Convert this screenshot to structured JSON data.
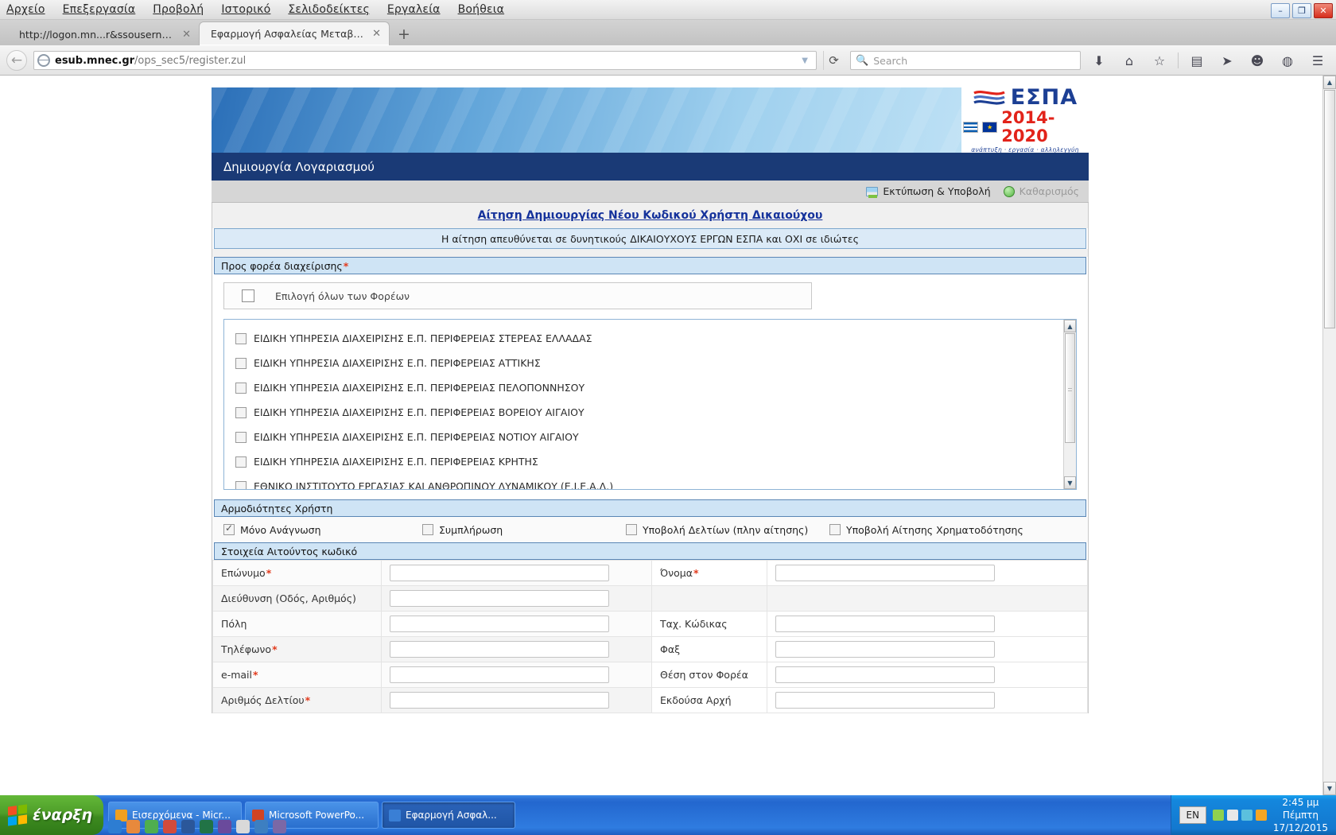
{
  "browser": {
    "menu": [
      "Αρχείο",
      "Επεξεργασία",
      "Προβολή",
      "Ιστορικό",
      "Σελιδοδείκτες",
      "Εργαλεία",
      "Βοήθεια"
    ],
    "window_controls": {
      "minimize": "–",
      "maximize": "❐",
      "close": "✕"
    },
    "tabs": [
      {
        "label": "http://logon.mn...r&ssousername=",
        "active": false
      },
      {
        "label": "Εφαρμογή Ασφαλείας Μεταβατικο...",
        "active": true
      }
    ],
    "new_tab_label": "+",
    "url_domain": "esub.mnec.gr",
    "url_path": "/ops_sec5/register.zul",
    "url_full": "esub.mnec.gr/ops_sec5/register.zul",
    "search_placeholder": "Search",
    "reload_label": "⟳",
    "back_label": "←",
    "toolbar_icons": [
      "download-icon",
      "home-icon",
      "bookmark-star-icon",
      "reader-icon",
      "pocket-icon",
      "smiley-icon",
      "sync-icon",
      "menu-hamburger-icon"
    ]
  },
  "page": {
    "espa_logo": {
      "word": "ΕΣΠΑ",
      "years": "2014-2020",
      "tagline": "ανάπτυξη · εργασία · αλληλεγγύη"
    },
    "title": "Δημιουργία Λογαριασμού",
    "toolbar": {
      "print_submit": "Εκτύπωση & Υποβολή",
      "clear": "Καθαρισμός"
    },
    "main_link": "Αίτηση Δημιουργίας Νέου Κωδικού Χρήστη Δικαιούχου",
    "notice": "Η αίτηση απευθύνεται σε δυνητικούς ΔΙΚΑΙΟΥΧΟΥΣ ΕΡΓΩΝ ΕΣΠΑ και ΟΧΙ σε ιδιώτες",
    "sections": {
      "authority": {
        "header": "Προς φορέα διαχείρισης",
        "required": "*",
        "select_all_label": "Επιλογή όλων των Φορέων",
        "select_all_checked": false,
        "items": [
          {
            "label": "ΕΙΔΙΚΗ ΥΠΗΡΕΣΙΑ ΔΙΑΧΕΙΡΙΣΗΣ Ε.Π. ΠΕΡΙΦΕΡΕΙΑΣ ΣΤΕΡΕΑΣ ΕΛΛΑΔΑΣ",
            "checked": false
          },
          {
            "label": "ΕΙΔΙΚΗ ΥΠΗΡΕΣΙΑ ΔΙΑΧΕΙΡΙΣΗΣ Ε.Π. ΠΕΡΙΦΕΡΕΙΑΣ ΑΤΤΙΚΗΣ",
            "checked": false
          },
          {
            "label": "ΕΙΔΙΚΗ ΥΠΗΡΕΣΙΑ ΔΙΑΧΕΙΡΙΣΗΣ Ε.Π. ΠΕΡΙΦΕΡΕΙΑΣ ΠΕΛΟΠΟΝΝΗΣΟΥ",
            "checked": false
          },
          {
            "label": "ΕΙΔΙΚΗ ΥΠΗΡΕΣΙΑ ΔΙΑΧΕΙΡΙΣΗΣ Ε.Π. ΠΕΡΙΦΕΡΕΙΑΣ ΒΟΡΕΙΟΥ ΑΙΓΑΙΟΥ",
            "checked": false
          },
          {
            "label": "ΕΙΔΙΚΗ ΥΠΗΡΕΣΙΑ ΔΙΑΧΕΙΡΙΣΗΣ Ε.Π. ΠΕΡΙΦΕΡΕΙΑΣ ΝΟΤΙΟΥ ΑΙΓΑΙΟΥ",
            "checked": false
          },
          {
            "label": "ΕΙΔΙΚΗ ΥΠΗΡΕΣΙΑ ΔΙΑΧΕΙΡΙΣΗΣ Ε.Π. ΠΕΡΙΦΕΡΕΙΑΣ ΚΡΗΤΗΣ",
            "checked": false
          },
          {
            "label": "ΕΘΝΙΚΟ ΙΝΣΤΙΤΟΥΤΟ ΕΡΓΑΣΙΑΣ ΚΑΙ ΑΝΘΡΩΠΙΝΟΥ ΔΥΝΑΜΙΚΟΥ (Ε.Ι.Ε.Α.Δ.)",
            "checked": false
          }
        ]
      },
      "permissions": {
        "header": "Αρμοδιότητες Χρήστη",
        "options": [
          {
            "label": "Μόνο Ανάγνωση",
            "checked": true
          },
          {
            "label": "Συμπλήρωση",
            "checked": false
          },
          {
            "label": "Υποβολή Δελτίων (πλην αίτησης)",
            "checked": false
          },
          {
            "label": "Υποβολή Αίτησης Χρηματοδότησης",
            "checked": false
          }
        ]
      },
      "applicant": {
        "header": "Στοιχεία Αιτούντος κωδικό",
        "rows": [
          {
            "left_label": "Επώνυμο",
            "left_required": true,
            "left_value": "",
            "right_label": "Όνομα",
            "right_required": true,
            "right_value": "",
            "right_has_input": true
          },
          {
            "left_label": "Διεύθυνση (Οδός, Αριθμός)",
            "left_required": false,
            "left_value": "",
            "right_label": "",
            "right_required": false,
            "right_value": "",
            "right_has_input": false
          },
          {
            "left_label": "Πόλη",
            "left_required": false,
            "left_value": "",
            "right_label": "Ταχ. Κώδικας",
            "right_required": false,
            "right_value": "",
            "right_has_input": true
          },
          {
            "left_label": "Τηλέφωνο",
            "left_required": true,
            "left_value": "",
            "right_label": "Φαξ",
            "right_required": false,
            "right_value": "",
            "right_has_input": true
          },
          {
            "left_label": "e-mail",
            "left_required": true,
            "left_value": "",
            "right_label": "Θέση στον Φορέα",
            "right_required": false,
            "right_value": "",
            "right_has_input": true
          },
          {
            "left_label": "Αριθμός Δελτίου",
            "left_required": true,
            "left_value": "",
            "right_label": "Εκδούσα Αρχή",
            "right_required": false,
            "right_value": "",
            "right_has_input": true
          }
        ]
      }
    }
  },
  "taskbar": {
    "start_label": "έναρξη",
    "items": [
      {
        "label": "Εισερχόμενα - Micr...",
        "active": false,
        "icon_color": "#f0a020"
      },
      {
        "label": "Microsoft PowerPo...",
        "active": false,
        "icon_color": "#d04423"
      },
      {
        "label": "Εφαρμογή Ασφαλ...",
        "active": true,
        "icon_color": "#3a7fd5"
      }
    ],
    "language": "EN",
    "clock_time": "2:45 μμ",
    "clock_day": "Πέμπτη",
    "clock_date": "17/12/2015"
  },
  "colors": {
    "banner_blue": "#1a3a76",
    "section_blue": "#cfe4f5",
    "link_blue": "#15329b",
    "required_red": "#e23a1c",
    "espa_blue": "#1c3f94",
    "espa_red": "#e2231a"
  }
}
